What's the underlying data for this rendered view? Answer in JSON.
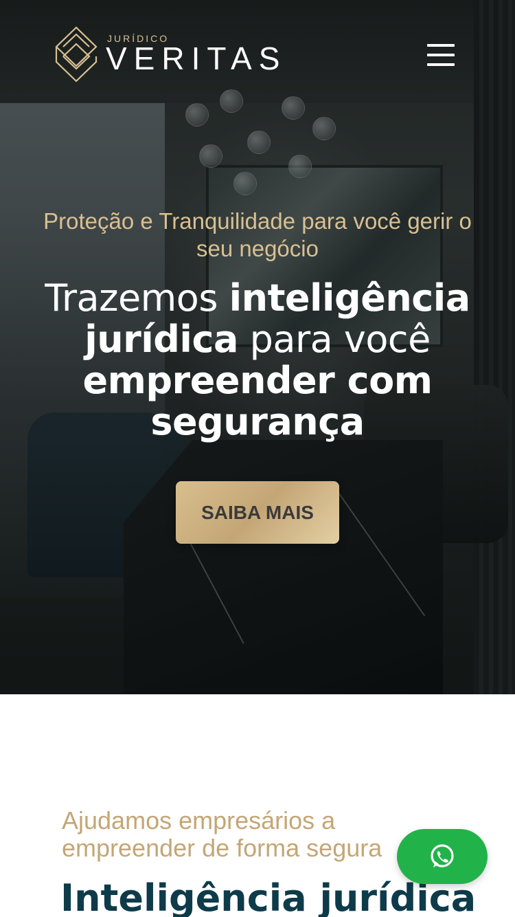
{
  "header": {
    "logo_sub": "JURÍDICO",
    "logo_main": "VERITAS",
    "menu_icon": "hamburger-menu-icon"
  },
  "hero": {
    "eyebrow": "Proteção e Tranquilidade para você gerir o seu negócio",
    "title_part1": "Trazemos ",
    "title_bold1": "inteligência jurídica",
    "title_part2": " para você ",
    "title_bold2": "empreender com segurança",
    "cta_label": "SAIBA MAIS"
  },
  "section2": {
    "eyebrow": "Ajudamos empresários a empreender de forma segura",
    "title": "Inteligência jurídica"
  },
  "floating": {
    "whatsapp_icon": "whatsapp-icon"
  },
  "colors": {
    "gold": "#c4a676",
    "gold_light": "#d9c092",
    "navy": "#0e3b4a",
    "whatsapp_green": "#22b24a"
  }
}
